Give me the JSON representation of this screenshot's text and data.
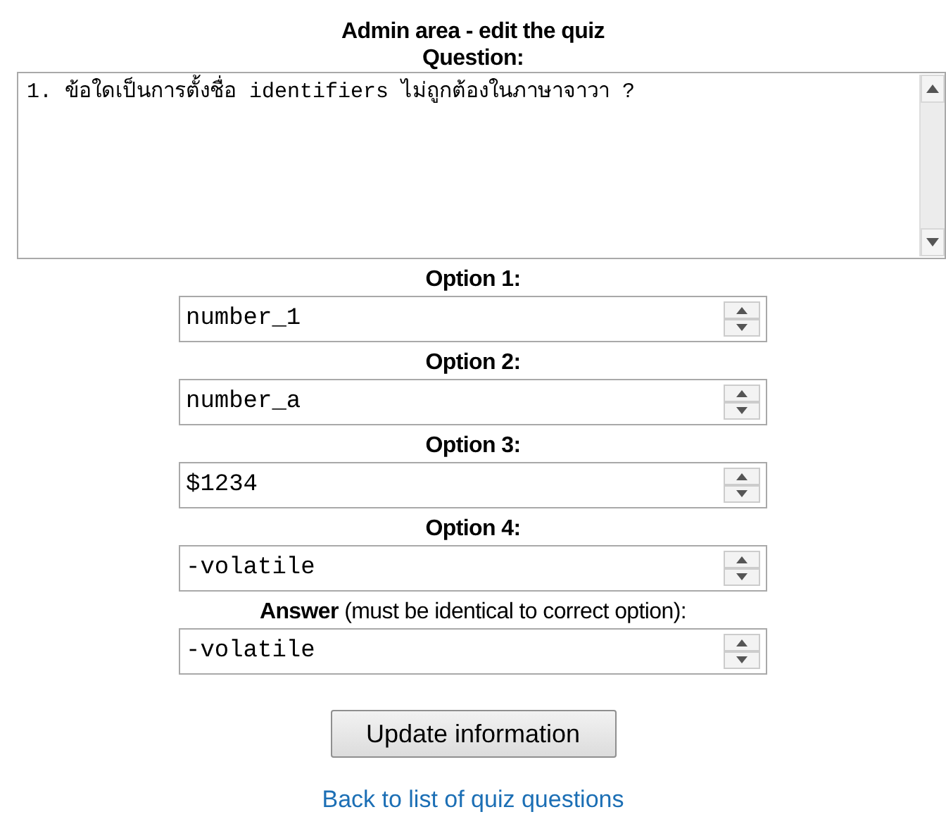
{
  "title": "Admin area - edit the quiz",
  "question": {
    "label": "Question:",
    "value": "1. ข้อใดเป็นการตั้งชื่อ identifiers ไม่ถูกต้องในภาษาจาวา ?"
  },
  "options": [
    {
      "label": "Option 1:",
      "value": "number_1"
    },
    {
      "label": "Option 2:",
      "value": "number_a"
    },
    {
      "label": "Option 3:",
      "value": "$1234"
    },
    {
      "label": "Option 4:",
      "value": "-volatile"
    }
  ],
  "answer": {
    "label": "**Answer** (must be identical to correct option):",
    "value": "-volatile"
  },
  "submit": "Update information",
  "back_link": "Back to list of quiz questions"
}
